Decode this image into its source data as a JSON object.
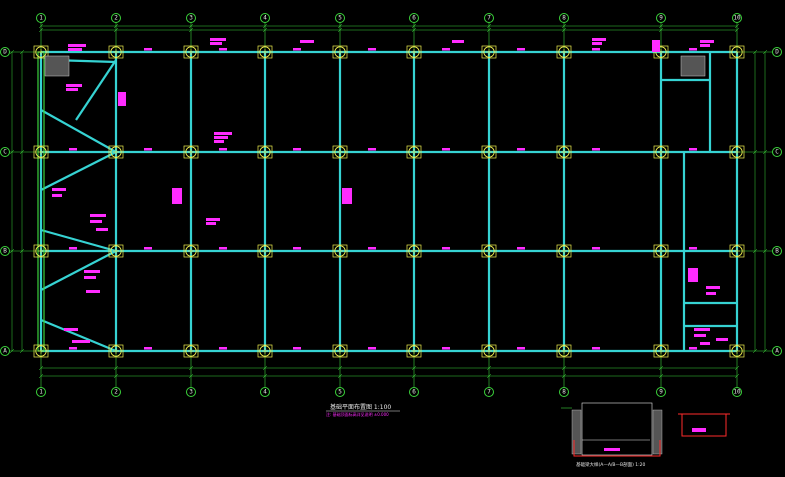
{
  "drawing": {
    "title": "基础平面布置图 1:100",
    "subtitle": "注: 基础顶面标高详见说明 ±0.000",
    "detail_title": "基础梁大样(A—A/B—B剖面) 1:20",
    "axes_x": [
      "1",
      "2",
      "3",
      "4",
      "5",
      "6",
      "7",
      "8",
      "9",
      "10"
    ],
    "axes_y": [
      "A",
      "B",
      "C",
      "D"
    ],
    "colors": {
      "grid": "#3bd33b",
      "beam": "#36d3d3",
      "column": "#f2f251",
      "annotation": "#ff2bff",
      "section": "#ff2b2b"
    }
  }
}
